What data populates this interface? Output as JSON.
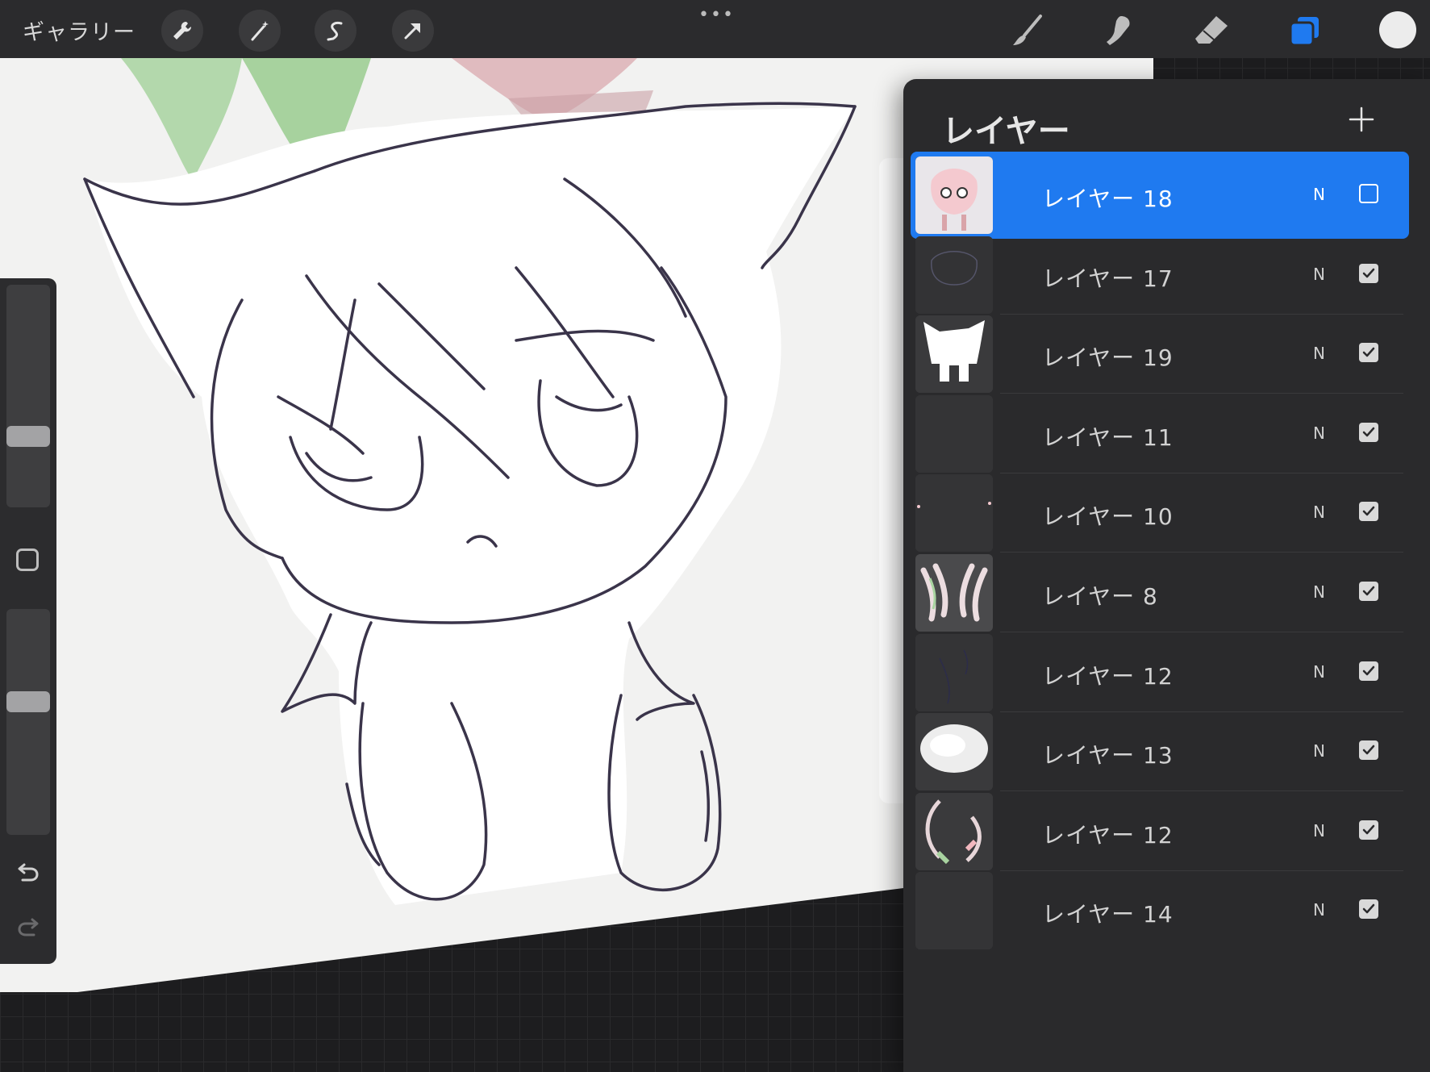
{
  "toolbar": {
    "gallery_label": "ギャラリー",
    "more_label": "•••",
    "accent_color": "#1f7af0"
  },
  "panel": {
    "title": "レイヤー",
    "add_label": "+"
  },
  "layers": [
    {
      "name": "レイヤー 18",
      "blend": "N",
      "visible": false,
      "selected": true
    },
    {
      "name": "レイヤー 17",
      "blend": "N",
      "visible": true,
      "selected": false
    },
    {
      "name": "レイヤー 19",
      "blend": "N",
      "visible": true,
      "selected": false
    },
    {
      "name": "レイヤー 11",
      "blend": "N",
      "visible": true,
      "selected": false
    },
    {
      "name": "レイヤー 10",
      "blend": "N",
      "visible": true,
      "selected": false
    },
    {
      "name": "レイヤー 8",
      "blend": "N",
      "visible": true,
      "selected": false
    },
    {
      "name": "レイヤー 12",
      "blend": "N",
      "visible": true,
      "selected": false
    },
    {
      "name": "レイヤー 13",
      "blend": "N",
      "visible": true,
      "selected": false
    },
    {
      "name": "レイヤー 12",
      "blend": "N",
      "visible": true,
      "selected": false
    },
    {
      "name": "レイヤー 14",
      "blend": "N",
      "visible": true,
      "selected": false
    }
  ],
  "sidebar": {
    "brush_size": 0.3,
    "opacity": 0.6
  }
}
